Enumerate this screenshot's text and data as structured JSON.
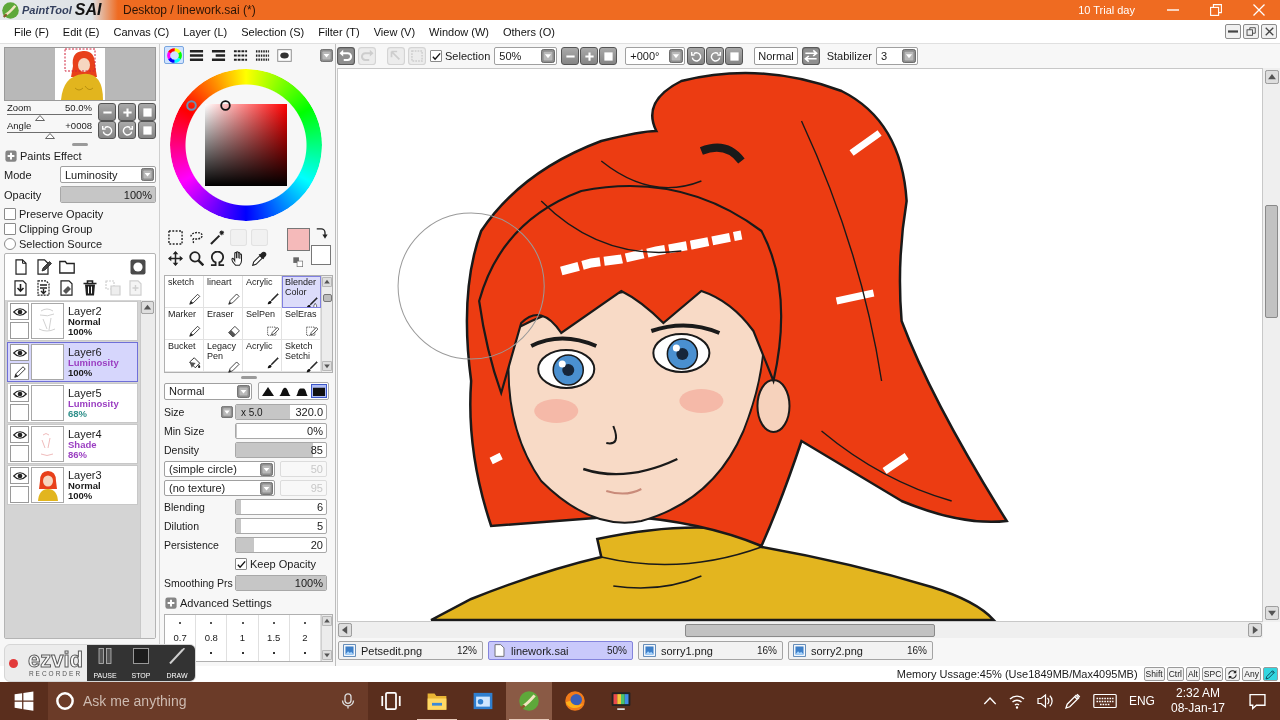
{
  "window": {
    "logo": {
      "name": "PaintTool",
      "brand": "SAI"
    },
    "title": "Desktop / linework.sai (*)",
    "trial": "10 Trial day"
  },
  "menu": [
    "File (F)",
    "Edit (E)",
    "Canvas (C)",
    "Layer (L)",
    "Selection (S)",
    "Filter (T)",
    "View (V)",
    "Window (W)",
    "Others (O)"
  ],
  "navigator": {
    "zoom": {
      "label": "Zoom",
      "value": "50.0%",
      "level": 0.39
    },
    "angle": {
      "label": "Angle",
      "value": "+0008",
      "level": 0.5
    }
  },
  "layer_properties": {
    "section": "Paints Effect",
    "mode": {
      "label": "Mode",
      "value": "Luminosity"
    },
    "opacity": {
      "label": "Opacity",
      "value": "100%",
      "level": 1
    },
    "options": [
      {
        "kind": "checkbox",
        "label": "Preserve Opacity",
        "checked": false
      },
      {
        "kind": "checkbox",
        "label": "Clipping Group",
        "checked": false
      },
      {
        "kind": "radio",
        "label": "Selection Source",
        "checked": false
      }
    ]
  },
  "layers": [
    {
      "name": "Layer2",
      "kind": "sketch",
      "mode": {
        "label": "Normal",
        "color": "#1a1a1a"
      },
      "opacity": {
        "label": "100%",
        "color": "#1a1a1a"
      },
      "visible": true,
      "selected": false
    },
    {
      "name": "Layer6",
      "kind": "blank",
      "mode": {
        "label": "Luminosity",
        "color": "#9b3fc2"
      },
      "opacity": {
        "label": "100%",
        "color": "#1a1a1a"
      },
      "visible": true,
      "selected": true
    },
    {
      "name": "Layer5",
      "kind": "blank",
      "mode": {
        "label": "Luminosity",
        "color": "#9b3fc2"
      },
      "opacity": {
        "label": "68%",
        "color": "#2e8f8a"
      },
      "visible": true,
      "selected": false
    },
    {
      "name": "Layer4",
      "kind": "shading",
      "mode": {
        "label": "Shade",
        "color": "#9b3fc2"
      },
      "opacity": {
        "label": "86%",
        "color": "#9b3fc2"
      },
      "visible": true,
      "selected": false
    },
    {
      "name": "Layer3",
      "kind": "figure",
      "mode": {
        "label": "Normal",
        "color": "#1a1a1a"
      },
      "opacity": {
        "label": "100%",
        "color": "#1a1a1a"
      },
      "visible": true,
      "selected": false
    }
  ],
  "color_panel": {
    "modes": [
      {
        "kind": "wheel",
        "selected": true
      },
      {
        "kind": "rgb",
        "selected": false
      },
      {
        "kind": "hsv",
        "selected": false
      },
      {
        "kind": "mixer",
        "selected": false
      },
      {
        "kind": "swatches",
        "selected": false
      },
      {
        "kind": "scratchpad",
        "selected": false
      }
    ],
    "colors": [
      {
        "color": "#f5baba"
      },
      {
        "color": "#ffffff"
      }
    ]
  },
  "tools": [
    {
      "kind": "rect-select",
      "disabled": false
    },
    {
      "kind": "lasso",
      "disabled": false
    },
    {
      "kind": "wand",
      "disabled": false
    },
    {
      "kind": "blank",
      "disabled": true
    },
    {
      "kind": "blank",
      "disabled": true
    },
    {
      "kind": "move",
      "disabled": false
    },
    {
      "kind": "zoom",
      "disabled": false
    },
    {
      "kind": "rotate",
      "disabled": false
    },
    {
      "kind": "hand",
      "disabled": false
    },
    {
      "kind": "eyedropper",
      "disabled": false
    }
  ],
  "brushes": [
    {
      "label": "sketch",
      "kind": "pencil",
      "selected": false
    },
    {
      "label": "lineart",
      "kind": "pen",
      "selected": false
    },
    {
      "label": "Acrylic",
      "kind": "brush",
      "selected": false
    },
    {
      "label": "Blender Color",
      "kind": "blender",
      "selected": true
    },
    {
      "label": "Marker",
      "kind": "pencil",
      "selected": false
    },
    {
      "label": "Eraser",
      "kind": "eraser",
      "selected": false
    },
    {
      "label": "SelPen",
      "kind": "selection",
      "selected": false
    },
    {
      "label": "SelEras",
      "kind": "selection",
      "selected": false
    },
    {
      "label": "Bucket",
      "kind": "bucket",
      "selected": false
    },
    {
      "label": "Legacy Pen",
      "kind": "pen",
      "selected": false
    },
    {
      "label": "Acrylic",
      "kind": "brush",
      "selected": false
    },
    {
      "label": "Sketch Setchi",
      "kind": "brush",
      "selected": false
    }
  ],
  "brush_settings": {
    "blend": "Normal",
    "shapes": [
      {
        "kind": "sharp",
        "selected": false
      },
      {
        "kind": "soft",
        "selected": false
      },
      {
        "kind": "flat",
        "selected": false
      },
      {
        "kind": "square",
        "selected": true
      }
    ],
    "rows": [
      {
        "kind": "slider",
        "label": "Size",
        "multiplier": "x 5.0",
        "value": "320.0",
        "level": 0.6
      },
      {
        "kind": "slider",
        "label": "Min Size",
        "value": "0%",
        "level": 0
      },
      {
        "kind": "slider",
        "label": "Density",
        "value": "85",
        "level": 0.85
      },
      {
        "kind": "select",
        "value": "(simple circle)",
        "amount": "50",
        "disabled": true
      },
      {
        "kind": "select",
        "value": "(no texture)",
        "amount": "95",
        "disabled": true
      },
      {
        "kind": "slider",
        "label": "Blending",
        "value": "6",
        "level": 0.06
      },
      {
        "kind": "slider",
        "label": "Dilution",
        "value": "5",
        "level": 0.05
      },
      {
        "kind": "slider",
        "label": "Persistence",
        "value": "20",
        "level": 0.2
      },
      {
        "kind": "check",
        "label": "Keep Opacity",
        "checked": true
      },
      {
        "kind": "slider",
        "label": "Smoothing Prs",
        "value": "100%",
        "level": 1
      }
    ],
    "advanced": {
      "label": "Advanced Settings",
      "pressure": [
        "0.7",
        "0.8",
        "1",
        "1.5",
        "2"
      ]
    }
  },
  "toolbar": {
    "buttons": [
      {
        "kind": "undo",
        "disabled": false
      },
      {
        "kind": "redo",
        "disabled": true
      },
      {
        "kind": "deselect",
        "disabled": true
      },
      {
        "kind": "invert",
        "disabled": true
      }
    ],
    "selection": {
      "label": "Selection",
      "checked": true
    },
    "zoom": "50%",
    "angle": "+000°",
    "blend": "Normal",
    "stabilizer": {
      "label": "Stabilizer",
      "value": "3"
    }
  },
  "documents": [
    {
      "name": "Petsedit.png",
      "zoom": "12%",
      "kind": "image",
      "selected": false
    },
    {
      "name": "linework.sai",
      "zoom": "50%",
      "kind": "document",
      "selected": true
    },
    {
      "name": "sorry1.png",
      "zoom": "16%",
      "kind": "image",
      "selected": false
    },
    {
      "name": "sorry2.png",
      "zoom": "16%",
      "kind": "image",
      "selected": false
    }
  ],
  "status_bar": {
    "memory": "Memory Ussage:45% (Use1849MB/Max4095MB)",
    "keys": [
      {
        "kind": "text",
        "label": "Shift",
        "active": false
      },
      {
        "kind": "text",
        "label": "Ctrl",
        "active": false
      },
      {
        "kind": "text",
        "label": "Alt",
        "active": false
      },
      {
        "kind": "text",
        "label": "SPC",
        "active": false
      },
      {
        "kind": "rotate",
        "active": false
      },
      {
        "kind": "text",
        "label": "Any",
        "active": false
      },
      {
        "kind": "pen",
        "active": true
      }
    ]
  },
  "recorder": {
    "logo": "ezvid",
    "subtitle": "RECORDER",
    "buttons": [
      {
        "kind": "pause",
        "label": "PAUSE"
      },
      {
        "kind": "stop",
        "label": "STOP"
      },
      {
        "kind": "draw",
        "label": "DRAW"
      }
    ]
  },
  "taskbar": {
    "search": {
      "placeholder": "Ask me anything"
    },
    "apps": [
      {
        "kind": "task-view",
        "open": false,
        "active": false
      },
      {
        "kind": "folder",
        "open": true,
        "active": false
      },
      {
        "kind": "mail",
        "open": false,
        "active": false
      },
      {
        "kind": "paint",
        "open": true,
        "active": true
      },
      {
        "kind": "browser",
        "open": false,
        "active": false
      },
      {
        "kind": "media",
        "open": false,
        "active": false
      }
    ],
    "tray": {
      "language": "ENG",
      "time": "2:32 AM",
      "date": "08-Jan-17"
    }
  }
}
